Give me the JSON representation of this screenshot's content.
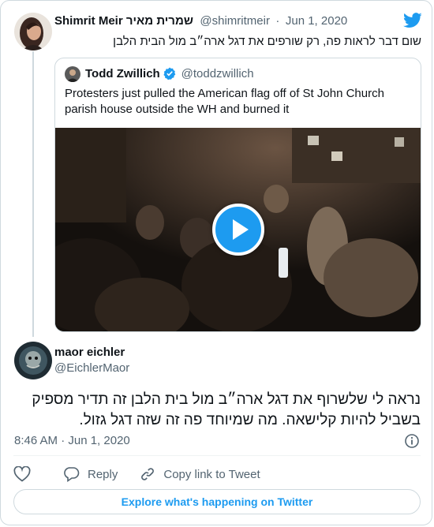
{
  "colors": {
    "accent": "#1d9bf0",
    "text": "#0f1419",
    "muted": "#536471",
    "border": "#cfd9de"
  },
  "original_tweet": {
    "display_name": "Shimrit Meir שמרית מאיר",
    "handle": "@shimritmeir",
    "date": "Jun 1, 2020",
    "separator": "·",
    "text": "שום דבר לראות פה, רק שורפים את דגל ארה״ב מול הבית הלבן"
  },
  "quoted_tweet": {
    "display_name": "Todd Zwillich",
    "handle": "@toddzwillich",
    "verified": true,
    "text": "Protesters just pulled the American flag off of St John Church parish house outside the WH and burned it",
    "media": {
      "type": "video",
      "icon": "play-icon"
    }
  },
  "reply_tweet": {
    "display_name": "maor eichler",
    "handle": "@EichlerMaor",
    "text_line1": "נראה לי שלשרוף את דגל ארה״ב מול בית הלבן זה תדיר מספיק",
    "text_line2": "בשביל להיות קלישאה. מה שמיוחד פה זה שזה דגל גזול.",
    "timestamp": "8:46 AM · Jun 1, 2020"
  },
  "actions": {
    "like_icon": "heart-icon",
    "reply_label": "Reply",
    "copy_label": "Copy link to Tweet"
  },
  "footer": {
    "explore_label": "Explore what's happening on Twitter"
  },
  "icons": {
    "brand": "twitter-bird-icon",
    "info": "info-icon"
  }
}
